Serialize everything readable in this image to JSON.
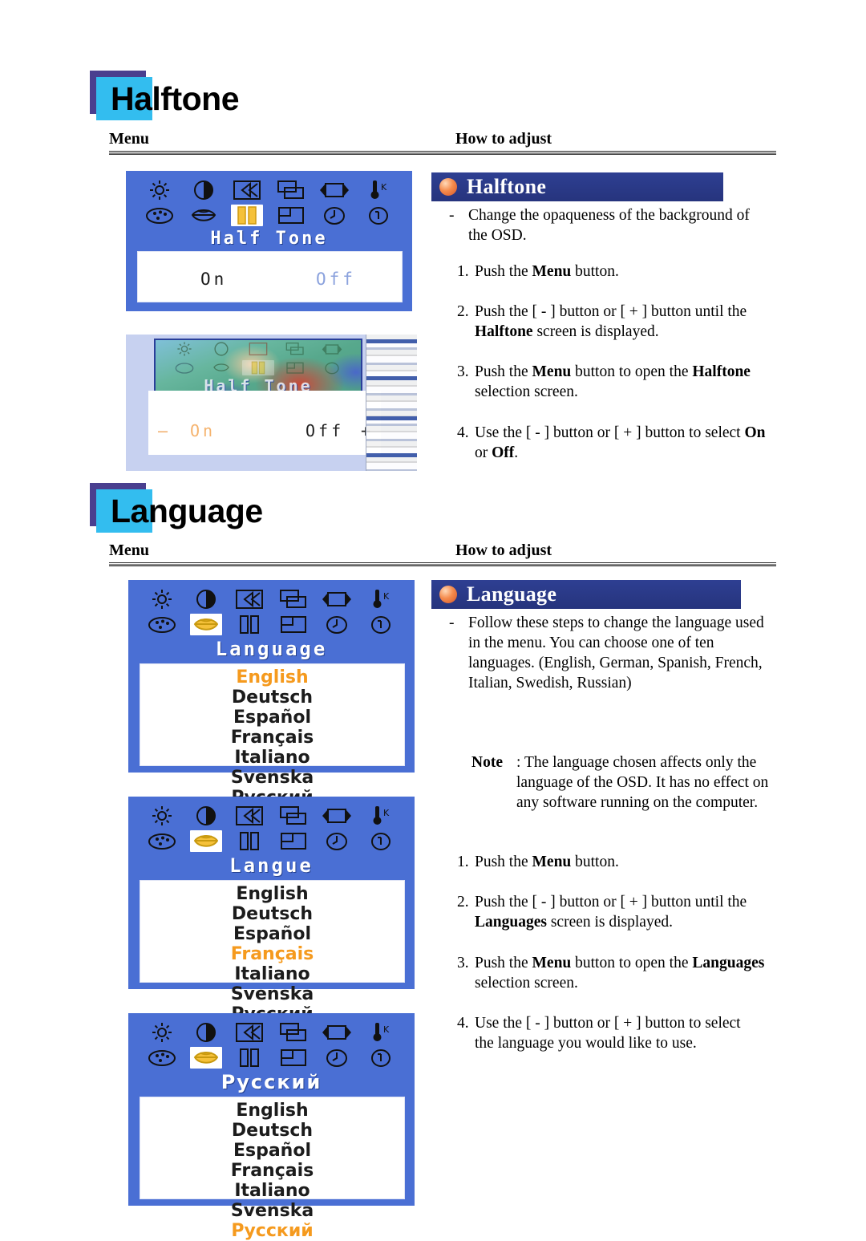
{
  "sections": [
    {
      "id": "halftone",
      "heading": "Halftone",
      "columns": {
        "menu": "Menu",
        "how": "How to adjust"
      },
      "panel_title": "Halftone",
      "osd": {
        "title": "Half Tone",
        "icons_row1": [
          "brightness-icon",
          "contrast-icon",
          "h-position-icon",
          "v-position-icon",
          "h-size-icon",
          "color-temp-icon"
        ],
        "icons_row2": [
          "color-adjust-icon",
          "language-icon",
          "halftone-icon",
          "osd-position-icon",
          "osd-timer-icon",
          "information-icon"
        ],
        "highlight_icon": "halftone-icon",
        "option_on": "On",
        "option_off": "Off"
      },
      "composite": {
        "title": "Half Tone",
        "minus": "—",
        "option_on": "On",
        "option_off": "Off",
        "plus": "+"
      },
      "description_dash": "-",
      "description": "Change the opaqueness of the background of the OSD.",
      "steps": [
        {
          "num": "1.",
          "parts": [
            {
              "t": "Push the ",
              "b": false
            },
            {
              "t": "Menu",
              "b": true
            },
            {
              "t": " button.",
              "b": false
            }
          ]
        },
        {
          "num": "2.",
          "parts": [
            {
              "t": "Push the [ - ]  button or [ + ]  button until the ",
              "b": false
            },
            {
              "t": "Halftone",
              "b": true
            },
            {
              "t": " screen is displayed.",
              "b": false
            }
          ]
        },
        {
          "num": "3.",
          "parts": [
            {
              "t": "Push the ",
              "b": false
            },
            {
              "t": "Menu",
              "b": true
            },
            {
              "t": " button to open the ",
              "b": false
            },
            {
              "t": "Halftone",
              "b": true
            },
            {
              "t": " selection screen.",
              "b": false
            }
          ]
        },
        {
          "num": "4.",
          "parts": [
            {
              "t": "Use the [ - ]  button or [ + ]  button to select ",
              "b": false
            },
            {
              "t": "On",
              "b": true
            },
            {
              "t": " or ",
              "b": false
            },
            {
              "t": "Off",
              "b": true
            },
            {
              "t": ".",
              "b": false
            }
          ]
        }
      ]
    },
    {
      "id": "language",
      "heading": "Language",
      "columns": {
        "menu": "Menu",
        "how": "How to adjust"
      },
      "panel_title": "Language",
      "language_items": [
        "English",
        "Deutsch",
        "Español",
        "Français",
        "Italiano",
        "Svenska",
        "Русский"
      ],
      "osd_panels": [
        {
          "title": "Language",
          "selected": "English"
        },
        {
          "title": "Langue",
          "selected": "Français"
        },
        {
          "title": "Русский",
          "selected": "Русский"
        }
      ],
      "icons_row1": [
        "brightness-icon",
        "contrast-icon",
        "h-position-icon",
        "v-position-icon",
        "h-size-icon",
        "color-temp-icon"
      ],
      "icons_row2": [
        "color-adjust-icon",
        "language-icon",
        "halftone-icon",
        "osd-position-icon",
        "osd-timer-icon",
        "information-icon"
      ],
      "highlight_icon": "language-icon",
      "description_dash": "-",
      "description": "Follow these steps to change the language used in the menu. You can choose one of ten languages. (English, German, Spanish, French, Italian, Swedish, Russian)",
      "note_label": "Note",
      "note_text": ": The language chosen affects only the language of the OSD. It has no effect on any software running on the computer.",
      "steps": [
        {
          "num": "1.",
          "parts": [
            {
              "t": "Push the ",
              "b": false
            },
            {
              "t": "Menu",
              "b": true
            },
            {
              "t": " button.",
              "b": false
            }
          ]
        },
        {
          "num": "2.",
          "parts": [
            {
              "t": "Push the [ - ]  button or [ + ]  button until the ",
              "b": false
            },
            {
              "t": "Languages",
              "b": true
            },
            {
              "t": " screen is displayed.",
              "b": false
            }
          ]
        },
        {
          "num": "3.",
          "parts": [
            {
              "t": "Push the ",
              "b": false
            },
            {
              "t": "Menu",
              "b": true
            },
            {
              "t": " button to open the ",
              "b": false
            },
            {
              "t": "Languages",
              "b": true
            },
            {
              "t": " selection screen.",
              "b": false
            }
          ]
        },
        {
          "num": "4.",
          "parts": [
            {
              "t": "Use the [ - ]  button or [ + ] button to select the language you would like to use.",
              "b": false
            }
          ]
        }
      ]
    }
  ],
  "colors": {
    "heading_square_back": "#4a3f8f",
    "heading_square_front": "#33bdef",
    "osd_blue": "#4a6fd4",
    "titlebar_blue": "#2e3f92",
    "selected_orange": "#f59a1e",
    "bullet_orange": "#f58b4c"
  }
}
